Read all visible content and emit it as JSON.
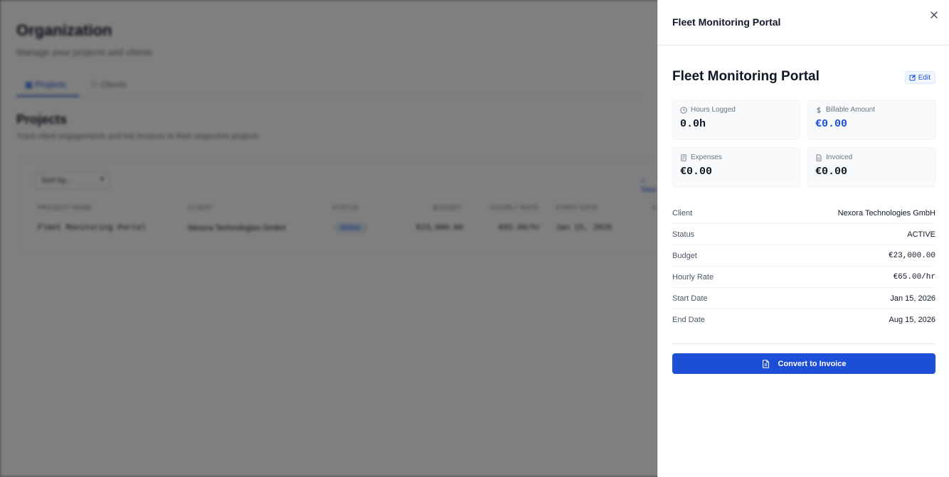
{
  "background": {
    "title": "Organization",
    "subtitle": "Manage your projects and clients",
    "tabs": [
      {
        "label": "Projects",
        "active": true
      },
      {
        "label": "Clients",
        "active": false
      }
    ],
    "section_title": "Projects",
    "section_subtitle": "Track client engagements and link invoices to their respective projects",
    "sort_label": "Sort by...",
    "action_link": "+ New",
    "table": {
      "headers": [
        "PROJECT NAME",
        "CLIENT",
        "STATUS",
        "BUDGET",
        "HOURLY RATE",
        "START DATE",
        "E"
      ],
      "rows": [
        [
          "Fleet Monitoring Portal",
          "Nexora Technologies GmbH",
          "Active",
          "€23,000.00",
          "€65.00/hr",
          "Jan 15, 2026",
          ""
        ]
      ]
    }
  },
  "drawer": {
    "header_title": "Fleet Monitoring Portal",
    "project_title": "Fleet Monitoring Portal",
    "edit_label": "Edit",
    "stats": {
      "hours": {
        "label": "Hours Logged",
        "value": "0.0h"
      },
      "billable": {
        "label": "Billable Amount",
        "value": "€0.00"
      },
      "expenses": {
        "label": "Expenses",
        "value": "€0.00"
      },
      "invoiced": {
        "label": "Invoiced",
        "value": "€0.00"
      }
    },
    "details": [
      {
        "label": "Client",
        "value": "Nexora Technologies GmbH"
      },
      {
        "label": "Status",
        "value": "ACTIVE"
      },
      {
        "label": "Budget",
        "value": "€23,000.00"
      },
      {
        "label": "Hourly Rate",
        "value": "€65.00/hr"
      },
      {
        "label": "Start Date",
        "value": "Jan 15, 2026"
      },
      {
        "label": "End Date",
        "value": "Aug 15, 2026"
      }
    ],
    "convert_label": "Convert to Invoice"
  },
  "colors": {
    "accent": "#1d4ed8",
    "overlay": "rgba(0,0,0,0.5)"
  },
  "icons": {
    "close": "close-icon",
    "edit": "edit-icon",
    "hours": "clock-icon",
    "billable": "dollar-icon",
    "expenses": "receipt-icon",
    "invoiced": "document-icon",
    "convert": "file-text-icon"
  }
}
